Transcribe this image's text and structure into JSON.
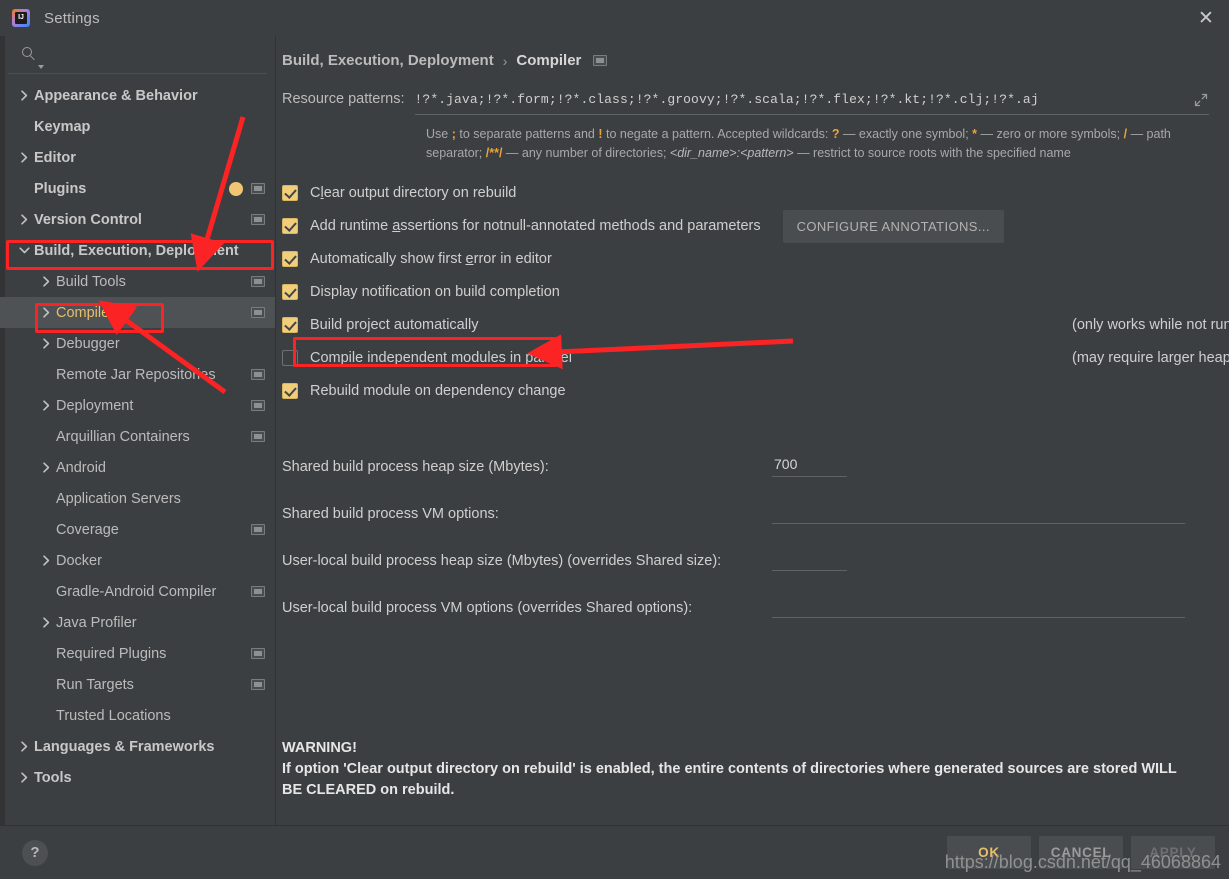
{
  "window": {
    "title": "Settings",
    "logo_icon": "intellij-idea-logo",
    "close_icon": "close-icon"
  },
  "sidebar": {
    "search": {
      "placeholder": "",
      "value": "",
      "icon": "search-icon",
      "caret_icon": "chevron-down-icon"
    },
    "items": [
      {
        "label": "Appearance & Behavior",
        "level": 0,
        "arrow": "right",
        "bold": true,
        "badge": "none",
        "selected": false
      },
      {
        "label": "Keymap",
        "level": 0,
        "arrow": "none",
        "bold": true,
        "badge": "none",
        "selected": false
      },
      {
        "label": "Editor",
        "level": 0,
        "arrow": "right",
        "bold": true,
        "badge": "none",
        "selected": false
      },
      {
        "label": "Plugins",
        "level": 0,
        "arrow": "none",
        "bold": true,
        "badge": "dot+project",
        "selected": false
      },
      {
        "label": "Version Control",
        "level": 0,
        "arrow": "right",
        "bold": true,
        "badge": "project",
        "selected": false
      },
      {
        "label": "Build, Execution, Deployment",
        "level": 0,
        "arrow": "down",
        "bold": true,
        "badge": "none",
        "selected": false
      },
      {
        "label": "Build Tools",
        "level": 1,
        "arrow": "right",
        "bold": false,
        "badge": "project",
        "selected": false
      },
      {
        "label": "Compiler",
        "level": 1,
        "arrow": "right",
        "bold": false,
        "badge": "project",
        "selected": true
      },
      {
        "label": "Debugger",
        "level": 1,
        "arrow": "right",
        "bold": false,
        "badge": "none",
        "selected": false
      },
      {
        "label": "Remote Jar Repositories",
        "level": 1,
        "arrow": "none",
        "bold": false,
        "badge": "project",
        "selected": false
      },
      {
        "label": "Deployment",
        "level": 1,
        "arrow": "right",
        "bold": false,
        "badge": "project",
        "selected": false
      },
      {
        "label": "Arquillian Containers",
        "level": 1,
        "arrow": "none",
        "bold": false,
        "badge": "project",
        "selected": false
      },
      {
        "label": "Android",
        "level": 1,
        "arrow": "right",
        "bold": false,
        "badge": "none",
        "selected": false
      },
      {
        "label": "Application Servers",
        "level": 1,
        "arrow": "none",
        "bold": false,
        "badge": "none",
        "selected": false
      },
      {
        "label": "Coverage",
        "level": 1,
        "arrow": "none",
        "bold": false,
        "badge": "project",
        "selected": false
      },
      {
        "label": "Docker",
        "level": 1,
        "arrow": "right",
        "bold": false,
        "badge": "none",
        "selected": false
      },
      {
        "label": "Gradle-Android Compiler",
        "level": 1,
        "arrow": "none",
        "bold": false,
        "badge": "project",
        "selected": false
      },
      {
        "label": "Java Profiler",
        "level": 1,
        "arrow": "right",
        "bold": false,
        "badge": "none",
        "selected": false
      },
      {
        "label": "Required Plugins",
        "level": 1,
        "arrow": "none",
        "bold": false,
        "badge": "project",
        "selected": false
      },
      {
        "label": "Run Targets",
        "level": 1,
        "arrow": "none",
        "bold": false,
        "badge": "project",
        "selected": false
      },
      {
        "label": "Trusted Locations",
        "level": 1,
        "arrow": "none",
        "bold": false,
        "badge": "none",
        "selected": false
      },
      {
        "label": "Languages & Frameworks",
        "level": 0,
        "arrow": "right",
        "bold": true,
        "badge": "none",
        "selected": false
      },
      {
        "label": "Tools",
        "level": 0,
        "arrow": "right",
        "bold": true,
        "badge": "none",
        "selected": false
      }
    ]
  },
  "main": {
    "breadcrumb": {
      "parent": "Build, Execution, Deployment",
      "separator": "›",
      "current": "Compiler",
      "badge_icon": "project-settings-badge-icon"
    },
    "resource_patterns": {
      "label": "Resource patterns:",
      "value": "!?*.java;!?*.form;!?*.class;!?*.groovy;!?*.scala;!?*.flex;!?*.kt;!?*.clj;!?*.aj",
      "expand_icon": "expand-icon"
    },
    "hint": {
      "p1": "Use ",
      "s1": ";",
      "p2": " to separate patterns and ",
      "s2": "!",
      "p3": " to negate a pattern. Accepted wildcards: ",
      "s3": "?",
      "p4": " — exactly one symbol; ",
      "s4": "*",
      "p5": " — zero or more symbols; ",
      "s5": "/",
      "p6": " — path separator; ",
      "s6": "/**/",
      "p7": " — any number of directories; ",
      "i1": "<dir_name>:<pattern>",
      "p8": " — restrict to source roots with the specified name"
    },
    "checkboxes": [
      {
        "label_pre": "C",
        "label_mn": "l",
        "label_post": "ear output directory on rebuild",
        "checked": true
      },
      {
        "label_pre": "Add runtime ",
        "label_mn": "a",
        "label_post": "ssertions for notnull-annotated methods and parameters",
        "checked": true
      },
      {
        "label_pre": "Automatically show first ",
        "label_mn": "e",
        "label_post": "rror in editor",
        "checked": true
      },
      {
        "label_pre": "Display notification on build completion",
        "label_mn": "",
        "label_post": "",
        "checked": true
      },
      {
        "label_pre": "Build project automatically",
        "label_mn": "",
        "label_post": "",
        "checked": true
      },
      {
        "label_pre": "Compile independent modules in parallel",
        "label_mn": "",
        "label_post": "",
        "checked": false
      },
      {
        "label_pre": "Rebuild module on dependency change",
        "label_mn": "",
        "label_post": "",
        "checked": true
      }
    ],
    "configure_annotations_button": "CONFIGURE ANNOTATIONS...",
    "notes": {
      "build_auto": "(only works while not running / debugging)",
      "parallel": "(may require larger heap size)"
    },
    "fields": [
      {
        "label": "Shared build process heap size (Mbytes):",
        "value": "700",
        "width": "small"
      },
      {
        "label": "Shared build process VM options:",
        "value": "",
        "width": "wide"
      },
      {
        "label": "User-local build process heap size (Mbytes) (overrides Shared size):",
        "value": "",
        "width": "small"
      },
      {
        "label": "User-local build process VM options (overrides Shared options):",
        "value": "",
        "width": "wide"
      }
    ],
    "warning": {
      "line1": "WARNING!",
      "line2": "If option 'Clear output directory on rebuild' is enabled, the entire contents of directories where generated sources are stored WILL BE CLEARED on rebuild."
    }
  },
  "footer": {
    "help_label": "?",
    "ok_label": "OK",
    "cancel_label": "CANCEL",
    "apply_label": "APPLY",
    "watermark": "https://blog.csdn.net/qq_46068864"
  },
  "colors": {
    "accent_yellow": "#e8bf6a",
    "checkbox_fill": "#f0ce7b",
    "annotation_red": "#fb2323",
    "window_bg": "#3c3f41",
    "selected_row": "#4e5254"
  }
}
